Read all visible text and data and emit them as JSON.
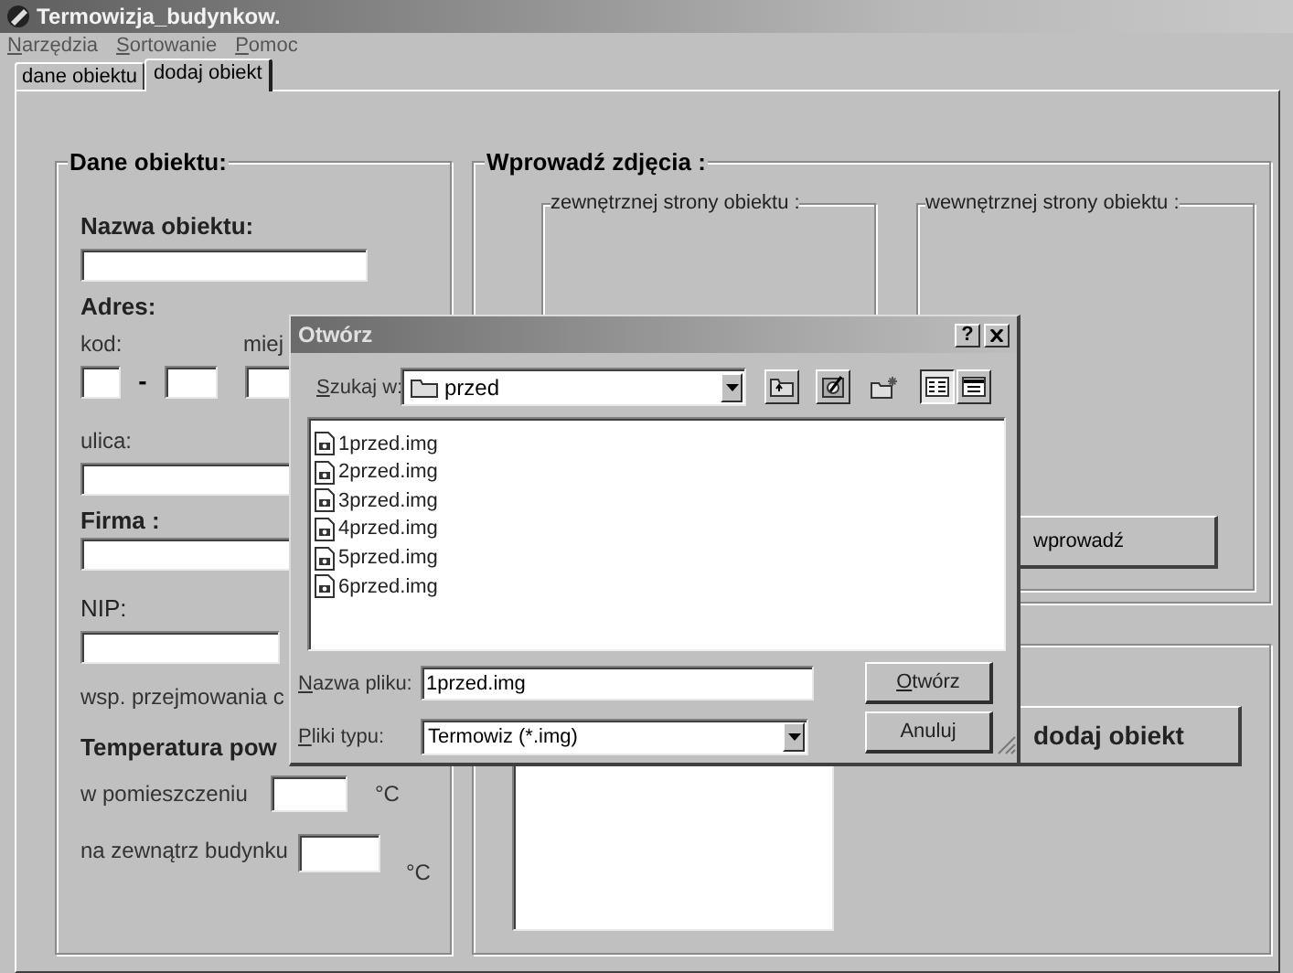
{
  "window": {
    "title": "Termowizja_budynkow."
  },
  "menu": [
    {
      "label": "Narzędzia",
      "mnemonic": true
    },
    {
      "label": "Sortowanie",
      "mnemonic": true
    },
    {
      "label": "Pomoc",
      "mnemonic": true
    }
  ],
  "tabs": [
    {
      "label": "dane obiektu",
      "selected": false
    },
    {
      "label": "dodaj obiekt",
      "selected": true
    }
  ],
  "object_data": {
    "title": "Dane obiektu:",
    "name_label": "Nazwa obiektu:",
    "address_label": "Adres:",
    "postcode_label": "kod:",
    "city_label": "miej",
    "dash": "-",
    "street_label": "ulica:",
    "company_label": "Firma :",
    "nip_label": "NIP:",
    "coefficient_label": "wsp. przejmowania c",
    "temperature_label": "Temperatura pow",
    "inside_label": "w pomieszczeniu",
    "inside_unit": "°C",
    "outside_label": "na zewnątrz budynku",
    "outside_unit": "°C"
  },
  "photos": {
    "title": "Wprowadź zdjęcia :",
    "outside_group": "zewnętrznej strony obiektu :",
    "inside_group": "wewnętrznej strony obiektu :",
    "enter_button": "wprowadź"
  },
  "add": {
    "button": "dodaj obiekt"
  },
  "dialog": {
    "title": "Otwórz",
    "help_button": "?",
    "look_in_label": {
      "label": "Szukaj w:",
      "mnemonic": true
    },
    "look_in": "przed",
    "files": [
      "1przed.img",
      "2przed.img",
      "3przed.img",
      "4przed.img",
      "5przed.img",
      "6przed.img"
    ],
    "filename_label": {
      "label": "Nazwa pliku:",
      "mnemonic": true
    },
    "filename": "1przed.img",
    "filetype_label": {
      "label": "Pliki typu:",
      "mnemonic": true
    },
    "filetype": "Termowiz (*.img)",
    "buttons": [
      {
        "label": "Otwórz",
        "mnemonic": true
      },
      {
        "label": "Anuluj",
        "mnemonic": false
      }
    ]
  }
}
